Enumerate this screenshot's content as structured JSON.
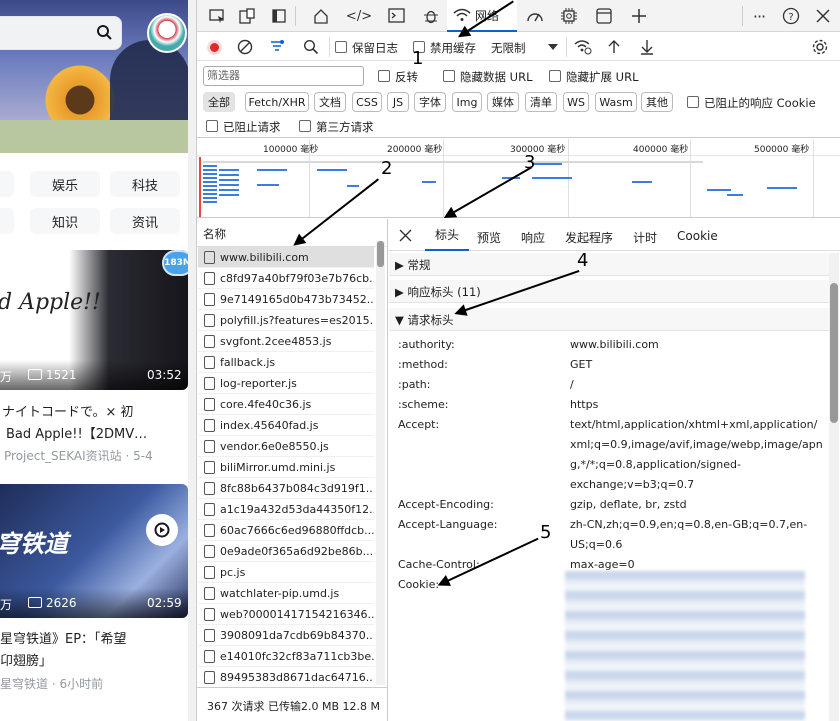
{
  "left": {
    "categories_row1": [
      "娱乐",
      "科技"
    ],
    "categories_row2": [
      "知识",
      "资讯"
    ],
    "video1": {
      "title_line1": "ナイトコードで。× 初",
      "title_line2": "Bad Apple!!【2DMV…",
      "author": "Project_SEKAI资讯站 · 5-4",
      "views": "万",
      "danmaku": "1521",
      "duration": "03:52",
      "badge": "183M",
      "cover_text": "d Apple!!"
    },
    "video2": {
      "title_line1": "星穹铁道》EP：「希望",
      "title_line2": "卬翅膀」",
      "author": "星穹铁道 · 6小时前",
      "views": "万",
      "danmaku": "2626",
      "duration": "02:59",
      "cover_text": "穹铁道"
    }
  },
  "devtools": {
    "tabs": {
      "network": "网络"
    },
    "toolbar": {
      "preserve_log": "保留日志",
      "disable_cache": "禁用缓存",
      "throttle": "无限制"
    },
    "filter": {
      "placeholder": "筛选器",
      "invert": "反转",
      "hide_data_url": "隐藏数据 URL",
      "hide_ext_url": "隐藏扩展 URL",
      "blocked_responses": "已阻止的响应 Cookie",
      "blocked_requests": "已阻止请求",
      "third_party": "第三方请求"
    },
    "type_filters": [
      "全部",
      "Fetch/XHR",
      "文档",
      "CSS",
      "JS",
      "字体",
      "Img",
      "媒体",
      "清单",
      "WS",
      "Wasm",
      "其他"
    ],
    "timeline_ticks": [
      "100000 毫秒",
      "200000 毫秒",
      "300000 毫秒",
      "400000 毫秒",
      "500000 毫秒"
    ],
    "list": {
      "header": "名称",
      "items": [
        "www.bilibili.com",
        "c8fd97a40bf79f03e7b76cb...",
        "9e7149165d0b473b73452...",
        "polyfill.js?features=es2015...",
        "svgfont.2cee4853.js",
        "fallback.js",
        "log-reporter.js",
        "core.4fe40c36.js",
        "index.45640fad.js",
        "vendor.6e0e8550.js",
        "biliMirror.umd.mini.js",
        "8fc88b6437b084c3d919f1...",
        "a1c19a432d53da44350f12...",
        "60ac7666c6ed96880ffdcb...",
        "0e9ade0f365a6d92be86b...",
        "pc.js",
        "watchlater-pip.umd.js",
        "web?00001417154216346...",
        "3908091da7cdb69b84370...",
        "e14010fc32cf83a711cb3be...",
        "89495383d8671dac64716..."
      ],
      "status": "367 次请求  已传输2.0 MB  12.8 M"
    },
    "detail_tabs": [
      "标头",
      "预览",
      "响应",
      "发起程序",
      "计时",
      "Cookie"
    ],
    "sections": {
      "general": "▶ 常规",
      "response_headers": "▶ 响应标头 (11)",
      "request_headers": "▼ 请求标头"
    },
    "headers": [
      {
        "name": ":authority:",
        "value": "www.bilibili.com"
      },
      {
        "name": ":method:",
        "value": "GET"
      },
      {
        "name": ":path:",
        "value": "/"
      },
      {
        "name": ":scheme:",
        "value": "https"
      },
      {
        "name": "Accept:",
        "value": "text/html,application/xhtml+xml,application/"
      },
      {
        "name": "",
        "value": "xml;q=0.9,image/avif,image/webp,image/apn"
      },
      {
        "name": "",
        "value": "g,*/*;q=0.8,application/signed-"
      },
      {
        "name": "",
        "value": "exchange;v=b3;q=0.7"
      },
      {
        "name": "Accept-Encoding:",
        "value": "gzip, deflate, br, zstd"
      },
      {
        "name": "Accept-Language:",
        "value": "zh-CN,zh;q=0.9,en;q=0.8,en-GB;q=0.7,en-"
      },
      {
        "name": "",
        "value": "US;q=0.6"
      },
      {
        "name": "Cache-Control:",
        "value": "max-age=0"
      },
      {
        "name": "Cookie:",
        "value": ""
      }
    ]
  },
  "annotations": [
    "1",
    "2",
    "3",
    "4",
    "5"
  ]
}
